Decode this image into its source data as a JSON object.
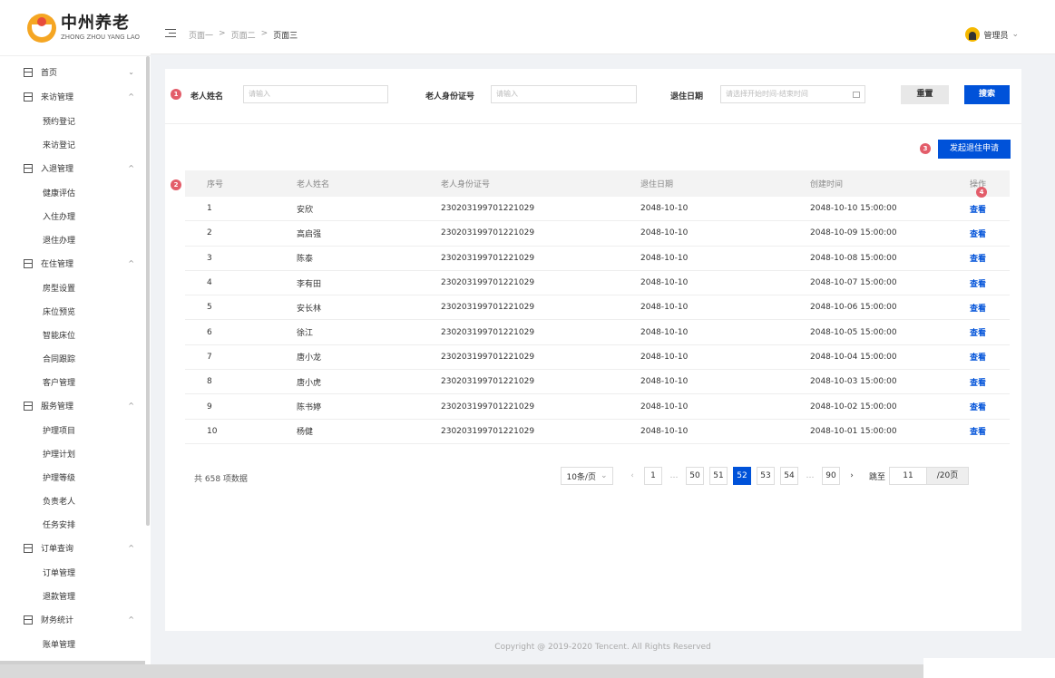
{
  "logo": {
    "cn": "中州养老",
    "en": "ZHONG ZHOU YANG LAO"
  },
  "sidebar": {
    "groups": [
      {
        "label": "首页",
        "chevron": "⌄",
        "items": []
      },
      {
        "label": "来访管理",
        "chevron": "^",
        "items": [
          "预约登记",
          "来访登记"
        ]
      },
      {
        "label": "入退管理",
        "chevron": "^",
        "items": [
          "健康评估",
          "入住办理",
          "退住办理"
        ]
      },
      {
        "label": "在住管理",
        "chevron": "^",
        "items": [
          "房型设置",
          "床位预览",
          "智能床位",
          "合同跟踪",
          "客户管理"
        ]
      },
      {
        "label": "服务管理",
        "chevron": "^",
        "items": [
          "护理项目",
          "护理计划",
          "护理等级",
          "负责老人",
          "任务安排"
        ]
      },
      {
        "label": "订单查询",
        "chevron": "^",
        "items": [
          "订单管理",
          "退款管理"
        ]
      },
      {
        "label": "财务统计",
        "chevron": "^",
        "items": [
          "账单管理"
        ]
      }
    ]
  },
  "header": {
    "breadcrumb": [
      "页面一",
      "页面二",
      "页面三"
    ],
    "breadcrumb_sep": ">",
    "user": "管理员",
    "user_chevron": "⌄"
  },
  "filters": {
    "badge": "1",
    "name_label": "老人姓名",
    "name_placeholder": "请输入",
    "id_label": "老人身份证号",
    "id_placeholder": "请输入",
    "date_label": "退住日期",
    "date_placeholder": "请选择开始时间-结束时间",
    "reset": "重置",
    "search": "搜索"
  },
  "apply": {
    "badge": "3",
    "label": "发起退住申请"
  },
  "table": {
    "badge": "2",
    "op_badge": "4",
    "columns": [
      "序号",
      "老人姓名",
      "老人身份证号",
      "退住日期",
      "创建时间",
      "操作"
    ],
    "rows": [
      [
        "1",
        "安欣",
        "230203199701221029",
        "2048-10-10",
        "2048-10-10 15:00:00",
        "查看"
      ],
      [
        "2",
        "高启强",
        "230203199701221029",
        "2048-10-10",
        "2048-10-09 15:00:00",
        "查看"
      ],
      [
        "3",
        "陈泰",
        "230203199701221029",
        "2048-10-10",
        "2048-10-08 15:00:00",
        "查看"
      ],
      [
        "4",
        "李有田",
        "230203199701221029",
        "2048-10-10",
        "2048-10-07 15:00:00",
        "查看"
      ],
      [
        "5",
        "安长林",
        "230203199701221029",
        "2048-10-10",
        "2048-10-06 15:00:00",
        "查看"
      ],
      [
        "6",
        "徐江",
        "230203199701221029",
        "2048-10-10",
        "2048-10-05 15:00:00",
        "查看"
      ],
      [
        "7",
        "唐小龙",
        "230203199701221029",
        "2048-10-10",
        "2048-10-04 15:00:00",
        "查看"
      ],
      [
        "8",
        "唐小虎",
        "230203199701221029",
        "2048-10-10",
        "2048-10-03 15:00:00",
        "查看"
      ],
      [
        "9",
        "陈书婷",
        "230203199701221029",
        "2048-10-10",
        "2048-10-02 15:00:00",
        "查看"
      ],
      [
        "10",
        "杨健",
        "230203199701221029",
        "2048-10-10",
        "2048-10-01 15:00:00",
        "查看"
      ]
    ]
  },
  "pagination": {
    "total": "共 658 项数据",
    "page_size": "10条/页",
    "page_size_chevron": "⌄",
    "prev": "‹",
    "next": "›",
    "pages": [
      "1",
      "…",
      "50",
      "51",
      "52",
      "53",
      "54",
      "…",
      "90"
    ],
    "current": "52",
    "jump_label": "跳至",
    "jump_value": "11",
    "jump_suffix": "/20页"
  },
  "footer": "Copyright @ 2019-2020 Tencent. All Rights Reserved",
  "colors": {
    "primary": "#0052d9",
    "badge": "#e35d6a",
    "logo": "#f5a623"
  }
}
